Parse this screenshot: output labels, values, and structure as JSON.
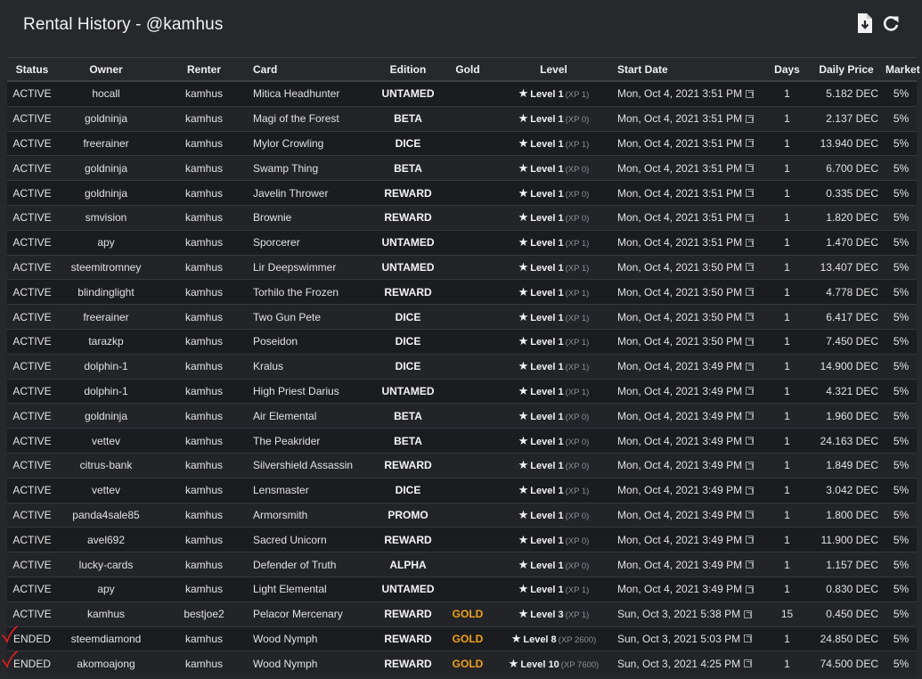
{
  "header": {
    "title": "Rental History - @kamhus"
  },
  "icons": {
    "download": "download-file-icon",
    "refresh": "refresh-icon",
    "external": "external-link-icon",
    "star": "star-icon",
    "check": "check-mark-icon"
  },
  "colors": {
    "background": "#26282c",
    "row_odd": "#1b1c1f",
    "row_even": "#232428",
    "gold": "#f0a21e",
    "check_mark": "#e02020"
  },
  "table": {
    "columns": [
      "Status",
      "Owner",
      "Renter",
      "Card",
      "Edition",
      "Gold",
      "Level",
      "Start Date",
      "Days",
      "Daily Price",
      "Market Fee"
    ],
    "rows": [
      {
        "status": "ACTIVE",
        "owner": "hocall",
        "renter": "kamhus",
        "card": "Mitica Headhunter",
        "edition": "UNTAMED",
        "gold": "",
        "level": "Level 1",
        "xp": "(XP 1)",
        "start": "Mon, Oct 4, 2021 3:51 PM",
        "days": "1",
        "price": "5.182 DEC",
        "fee": "5%"
      },
      {
        "status": "ACTIVE",
        "owner": "goldninja",
        "renter": "kamhus",
        "card": "Magi of the Forest",
        "edition": "BETA",
        "gold": "",
        "level": "Level 1",
        "xp": "(XP 0)",
        "start": "Mon, Oct 4, 2021 3:51 PM",
        "days": "1",
        "price": "2.137 DEC",
        "fee": "5%"
      },
      {
        "status": "ACTIVE",
        "owner": "freerainer",
        "renter": "kamhus",
        "card": "Mylor Crowling",
        "edition": "DICE",
        "gold": "",
        "level": "Level 1",
        "xp": "(XP 1)",
        "start": "Mon, Oct 4, 2021 3:51 PM",
        "days": "1",
        "price": "13.940 DEC",
        "fee": "5%"
      },
      {
        "status": "ACTIVE",
        "owner": "goldninja",
        "renter": "kamhus",
        "card": "Swamp Thing",
        "edition": "BETA",
        "gold": "",
        "level": "Level 1",
        "xp": "(XP 0)",
        "start": "Mon, Oct 4, 2021 3:51 PM",
        "days": "1",
        "price": "6.700 DEC",
        "fee": "5%"
      },
      {
        "status": "ACTIVE",
        "owner": "goldninja",
        "renter": "kamhus",
        "card": "Javelin Thrower",
        "edition": "REWARD",
        "gold": "",
        "level": "Level 1",
        "xp": "(XP 0)",
        "start": "Mon, Oct 4, 2021 3:51 PM",
        "days": "1",
        "price": "0.335 DEC",
        "fee": "5%"
      },
      {
        "status": "ACTIVE",
        "owner": "smvision",
        "renter": "kamhus",
        "card": "Brownie",
        "edition": "REWARD",
        "gold": "",
        "level": "Level 1",
        "xp": "(XP 0)",
        "start": "Mon, Oct 4, 2021 3:51 PM",
        "days": "1",
        "price": "1.820 DEC",
        "fee": "5%"
      },
      {
        "status": "ACTIVE",
        "owner": "apy",
        "renter": "kamhus",
        "card": "Sporcerer",
        "edition": "UNTAMED",
        "gold": "",
        "level": "Level 1",
        "xp": "(XP 1)",
        "start": "Mon, Oct 4, 2021 3:51 PM",
        "days": "1",
        "price": "1.470 DEC",
        "fee": "5%"
      },
      {
        "status": "ACTIVE",
        "owner": "steemitromney",
        "renter": "kamhus",
        "card": "Lir Deepswimmer",
        "edition": "UNTAMED",
        "gold": "",
        "level": "Level 1",
        "xp": "(XP 1)",
        "start": "Mon, Oct 4, 2021 3:50 PM",
        "days": "1",
        "price": "13.407 DEC",
        "fee": "5%"
      },
      {
        "status": "ACTIVE",
        "owner": "blindinglight",
        "renter": "kamhus",
        "card": "Torhilo the Frozen",
        "edition": "REWARD",
        "gold": "",
        "level": "Level 1",
        "xp": "(XP 1)",
        "start": "Mon, Oct 4, 2021 3:50 PM",
        "days": "1",
        "price": "4.778 DEC",
        "fee": "5%"
      },
      {
        "status": "ACTIVE",
        "owner": "freerainer",
        "renter": "kamhus",
        "card": "Two Gun Pete",
        "edition": "DICE",
        "gold": "",
        "level": "Level 1",
        "xp": "(XP 1)",
        "start": "Mon, Oct 4, 2021 3:50 PM",
        "days": "1",
        "price": "6.417 DEC",
        "fee": "5%"
      },
      {
        "status": "ACTIVE",
        "owner": "tarazkp",
        "renter": "kamhus",
        "card": "Poseidon",
        "edition": "DICE",
        "gold": "",
        "level": "Level 1",
        "xp": "(XP 1)",
        "start": "Mon, Oct 4, 2021 3:50 PM",
        "days": "1",
        "price": "7.450 DEC",
        "fee": "5%"
      },
      {
        "status": "ACTIVE",
        "owner": "dolphin-1",
        "renter": "kamhus",
        "card": "Kralus",
        "edition": "DICE",
        "gold": "",
        "level": "Level 1",
        "xp": "(XP 1)",
        "start": "Mon, Oct 4, 2021 3:49 PM",
        "days": "1",
        "price": "14.900 DEC",
        "fee": "5%"
      },
      {
        "status": "ACTIVE",
        "owner": "dolphin-1",
        "renter": "kamhus",
        "card": "High Priest Darius",
        "edition": "UNTAMED",
        "gold": "",
        "level": "Level 1",
        "xp": "(XP 1)",
        "start": "Mon, Oct 4, 2021 3:49 PM",
        "days": "1",
        "price": "4.321 DEC",
        "fee": "5%"
      },
      {
        "status": "ACTIVE",
        "owner": "goldninja",
        "renter": "kamhus",
        "card": "Air Elemental",
        "edition": "BETA",
        "gold": "",
        "level": "Level 1",
        "xp": "(XP 0)",
        "start": "Mon, Oct 4, 2021 3:49 PM",
        "days": "1",
        "price": "1.960 DEC",
        "fee": "5%"
      },
      {
        "status": "ACTIVE",
        "owner": "vettev",
        "renter": "kamhus",
        "card": "The Peakrider",
        "edition": "BETA",
        "gold": "",
        "level": "Level 1",
        "xp": "(XP 0)",
        "start": "Mon, Oct 4, 2021 3:49 PM",
        "days": "1",
        "price": "24.163 DEC",
        "fee": "5%"
      },
      {
        "status": "ACTIVE",
        "owner": "citrus-bank",
        "renter": "kamhus",
        "card": "Silvershield Assassin",
        "edition": "REWARD",
        "gold": "",
        "level": "Level 1",
        "xp": "(XP 0)",
        "start": "Mon, Oct 4, 2021 3:49 PM",
        "days": "1",
        "price": "1.849 DEC",
        "fee": "5%"
      },
      {
        "status": "ACTIVE",
        "owner": "vettev",
        "renter": "kamhus",
        "card": "Lensmaster",
        "edition": "DICE",
        "gold": "",
        "level": "Level 1",
        "xp": "(XP 1)",
        "start": "Mon, Oct 4, 2021 3:49 PM",
        "days": "1",
        "price": "3.042 DEC",
        "fee": "5%"
      },
      {
        "status": "ACTIVE",
        "owner": "panda4sale85",
        "renter": "kamhus",
        "card": "Armorsmith",
        "edition": "PROMO",
        "gold": "",
        "level": "Level 1",
        "xp": "(XP 0)",
        "start": "Mon, Oct 4, 2021 3:49 PM",
        "days": "1",
        "price": "1.800 DEC",
        "fee": "5%"
      },
      {
        "status": "ACTIVE",
        "owner": "avel692",
        "renter": "kamhus",
        "card": "Sacred Unicorn",
        "edition": "REWARD",
        "gold": "",
        "level": "Level 1",
        "xp": "(XP 0)",
        "start": "Mon, Oct 4, 2021 3:49 PM",
        "days": "1",
        "price": "11.900 DEC",
        "fee": "5%"
      },
      {
        "status": "ACTIVE",
        "owner": "lucky-cards",
        "renter": "kamhus",
        "card": "Defender of Truth",
        "edition": "ALPHA",
        "gold": "",
        "level": "Level 1",
        "xp": "(XP 0)",
        "start": "Mon, Oct 4, 2021 3:49 PM",
        "days": "1",
        "price": "1.157 DEC",
        "fee": "5%"
      },
      {
        "status": "ACTIVE",
        "owner": "apy",
        "renter": "kamhus",
        "card": "Light Elemental",
        "edition": "UNTAMED",
        "gold": "",
        "level": "Level 1",
        "xp": "(XP 1)",
        "start": "Mon, Oct 4, 2021 3:49 PM",
        "days": "1",
        "price": "0.830 DEC",
        "fee": "5%"
      },
      {
        "status": "ACTIVE",
        "owner": "kamhus",
        "renter": "bestjoe2",
        "card": "Pelacor Mercenary",
        "edition": "REWARD",
        "gold": "GOLD",
        "level": "Level 3",
        "xp": "(XP 1)",
        "start": "Sun, Oct 3, 2021 5:38 PM",
        "days": "15",
        "price": "0.450 DEC",
        "fee": "5%"
      },
      {
        "status": "ENDED",
        "owner": "steemdiamond",
        "renter": "kamhus",
        "card": "Wood Nymph",
        "edition": "REWARD",
        "gold": "GOLD",
        "level": "Level 8",
        "xp": "(XP 2600)",
        "start": "Sun, Oct 3, 2021 5:03 PM",
        "days": "1",
        "price": "24.850 DEC",
        "fee": "5%",
        "checked": true
      },
      {
        "status": "ENDED",
        "owner": "akomoajong",
        "renter": "kamhus",
        "card": "Wood Nymph",
        "edition": "REWARD",
        "gold": "GOLD",
        "level": "Level 10",
        "xp": "(XP 7600)",
        "start": "Sun, Oct 3, 2021 4:25 PM",
        "days": "1",
        "price": "74.500 DEC",
        "fee": "5%",
        "checked": true
      }
    ]
  }
}
